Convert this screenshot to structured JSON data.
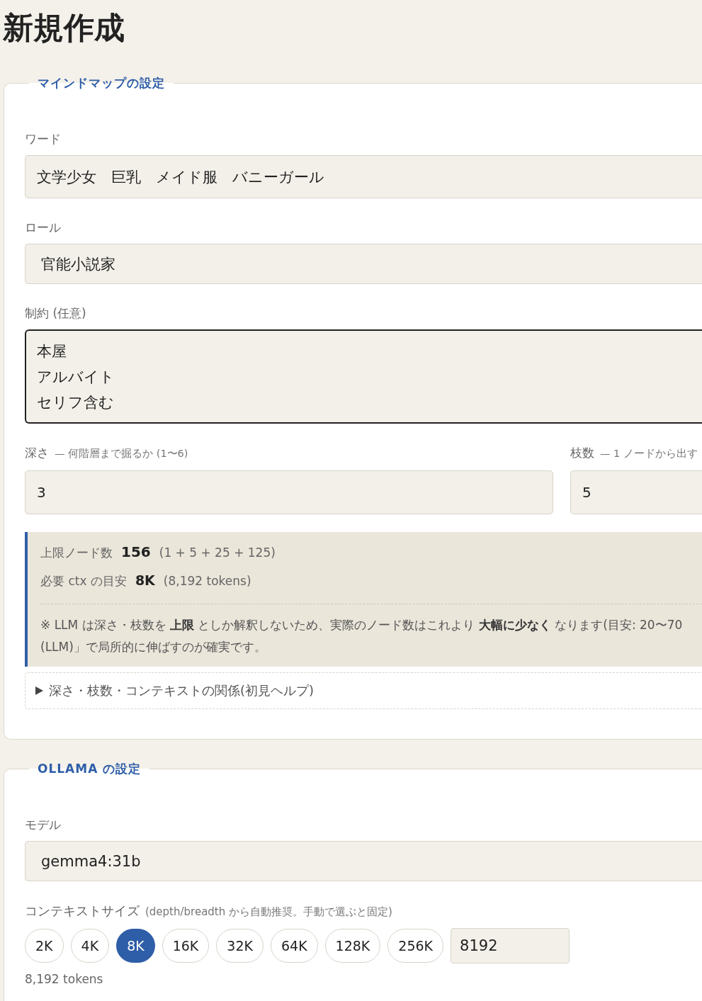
{
  "page_title": "新規作成",
  "mindmap_settings": {
    "legend": "マインドマップの設定",
    "word": {
      "label": "ワード",
      "value": "文学少女　巨乳　メイド服　バニーガール"
    },
    "role": {
      "label": "ロール",
      "value": "官能小説家"
    },
    "constraints": {
      "label": "制約 (任意)",
      "lines": [
        "本屋",
        "アルバイト",
        "セリフ含む"
      ],
      "focused": true
    },
    "depth": {
      "label": "深さ",
      "hint": "— 何階層まで掘るか (1〜6)",
      "value": "3"
    },
    "breadth": {
      "label": "枝数",
      "hint": "— 1 ノードから出す",
      "value": "5"
    },
    "estimate": {
      "max_nodes_label": "上限ノード数",
      "max_nodes": "156",
      "max_nodes_formula": "(1 + 5 + 25 + 125)",
      "ctx_label": "必要 ctx の目安",
      "ctx": "8K",
      "ctx_tokens": "(8,192 tokens)",
      "note_lines": [
        "※ LLM は深さ・枝数を **上限** としか解釈しないため、実際のノード数はこれより **大幅に少なく** なります(目安: 20〜70",
        "(LLM)」で局所的に伸ばすのが確実です。"
      ]
    },
    "help": {
      "label": "深さ・枝数・コンテキストの関係(初見ヘルプ)",
      "expanded": false
    }
  },
  "ollama_settings": {
    "legend": "OLLAMA の設定",
    "model": {
      "label": "モデル",
      "value": "gemma4:31b"
    },
    "context_size": {
      "label": "コンテキストサイズ",
      "hint": "(depth/breadth から自動推奨。手動で選ぶと固定)",
      "options": [
        {
          "label": "2K",
          "selected": false
        },
        {
          "label": "4K",
          "selected": false
        },
        {
          "label": "8K",
          "selected": true
        },
        {
          "label": "16K",
          "selected": false
        },
        {
          "label": "32K",
          "selected": false
        },
        {
          "label": "64K",
          "selected": false
        },
        {
          "label": "128K",
          "selected": false
        },
        {
          "label": "256K",
          "selected": false
        }
      ],
      "custom_value": "8192",
      "tokens": "8,192 tokens"
    }
  }
}
